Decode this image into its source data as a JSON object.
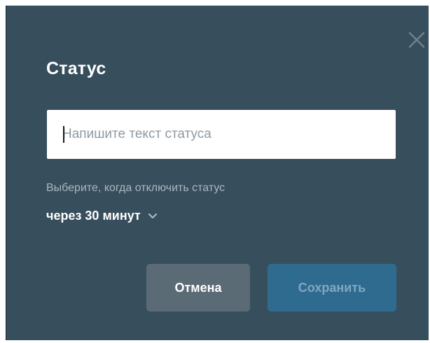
{
  "dialog": {
    "title": "Статус",
    "status_input": {
      "value": "",
      "placeholder": "Напишите текст статуса"
    },
    "clear_hint": "Выберите, когда отключить статус",
    "clear_after": "через 30 минут",
    "buttons": {
      "cancel": "Отмена",
      "save": "Сохранить"
    }
  },
  "icons": {
    "close": "close-icon",
    "dropdown": "chevron-down-icon"
  },
  "colors": {
    "dialog_bg": "#374e5c",
    "cancel_bg": "#5a6b76",
    "save_bg": "#2f6b8f",
    "save_text": "#7fa7c0",
    "hint_text": "#a9b8c2"
  }
}
